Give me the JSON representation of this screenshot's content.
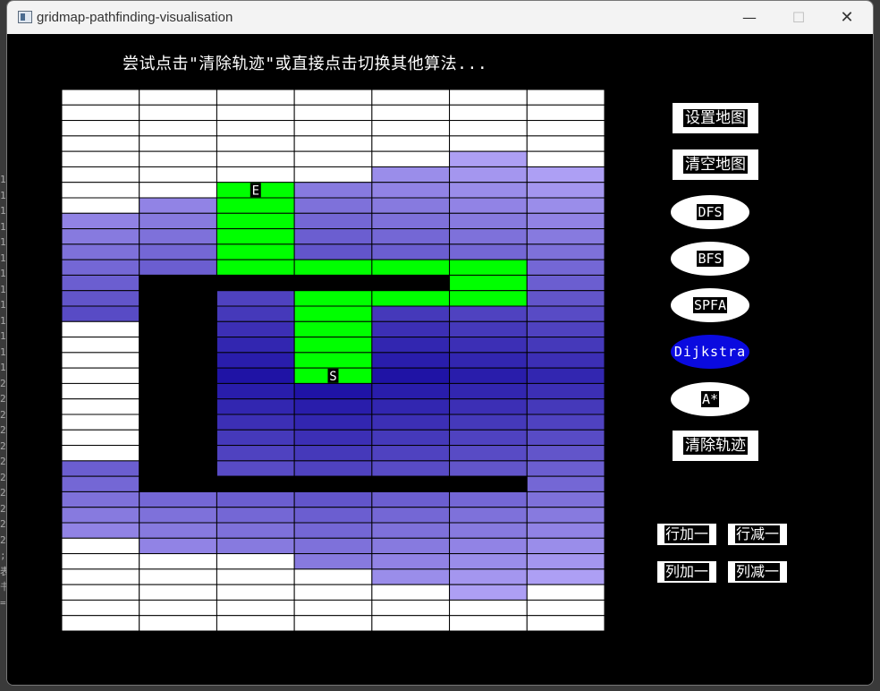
{
  "window": {
    "title": "gridmap-pathfinding-visualisation",
    "minimize_glyph": "—",
    "maximize_glyph": "☐",
    "close_glyph": "✕"
  },
  "hint": "尝试点击\"清除轨迹\"或直接点击切换其他算法...",
  "grid": {
    "rows": 35,
    "cols": 7,
    "start_label": "S",
    "end_label": "E",
    "start": [
      18,
      3
    ],
    "end": [
      6,
      2
    ],
    "colors": {
      "unvisited": "#ffffff",
      "wall": "#000000",
      "path": "#00ff00",
      "line": "#000000"
    },
    "cells": [
      "0000000",
      "0000000",
      "0000000",
      "0000000",
      "0000010",
      "0000111",
      "00E1111",
      "01P1111",
      "11P1111",
      "11P1111",
      "11P1111",
      "11PPPP1",
      "1####P1",
      "1#1PPP1",
      "1#1P111",
      "0#1P111",
      "0#1P111",
      "0#1P111",
      "0#1S111",
      "0#11111",
      "0#11111",
      "0#11111",
      "0#11111",
      "0#11111",
      "1#11111",
      "1#####1",
      "1111111",
      "1111111",
      "1111111",
      "0111111",
      "0001111",
      "0000111",
      "0000010",
      "0000000",
      "0000000"
    ]
  },
  "buttons": {
    "set_map": "设置地图",
    "clear_map": "清空地图",
    "dfs": "DFS",
    "bfs": "BFS",
    "spfa": "SPFA",
    "dijkstra": "Dijkstra",
    "astar": "A*",
    "clear_trace": "清除轨迹",
    "row_add": "行加一",
    "row_sub": "行减一",
    "col_add": "列加一",
    "col_sub": "列减一"
  },
  "active_algorithm": "Dijkstra",
  "colors": {
    "active_button": "#0a0adf",
    "button_bg": "#ffffff",
    "canvas_bg": "#000000"
  },
  "background_chars": "1\n1\n1\n1\n1\n1\n1\n1\n1\n1\n1\n1\n1\n2\n2\n2\n2\n2\n2\n2\n2\n2\n2\n2\n;\n表\n书\n="
}
